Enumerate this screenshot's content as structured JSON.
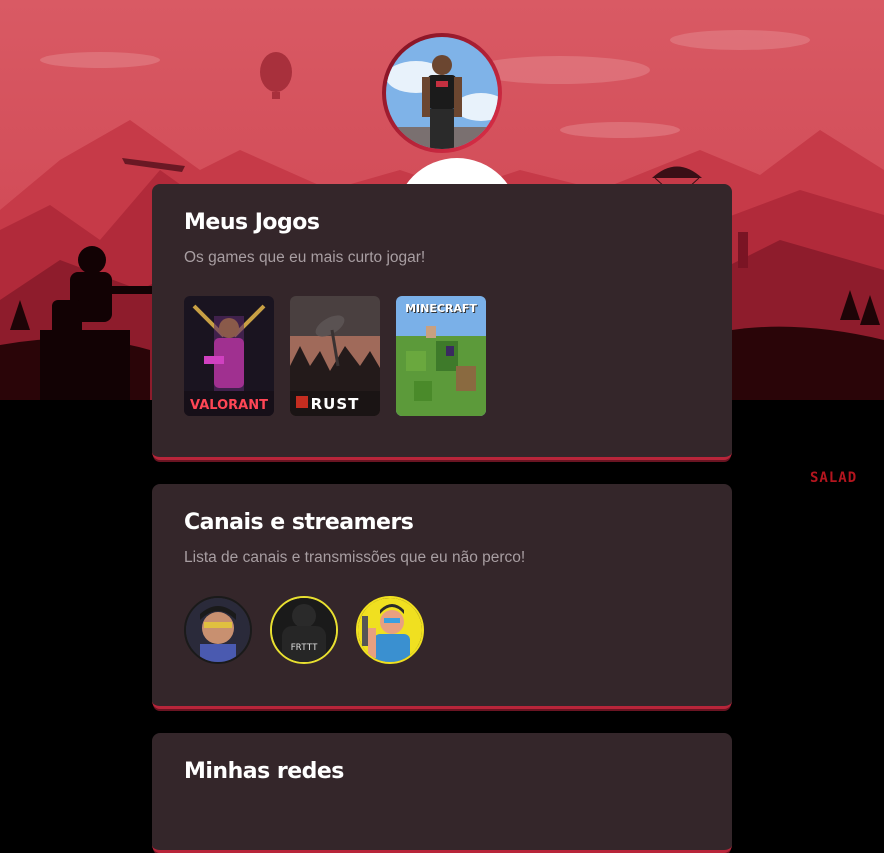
{
  "profile": {
    "avatar_icon": "profile-photo"
  },
  "sections": {
    "games": {
      "title": "Meus Jogos",
      "subtitle": "Os games que eu mais curto jogar!",
      "items": [
        {
          "name": "VALORANT",
          "icon": "valorant-cover"
        },
        {
          "name": "RUST",
          "icon": "rust-cover"
        },
        {
          "name": "MINECRAFT",
          "icon": "minecraft-cover"
        }
      ]
    },
    "streams": {
      "title": "Canais e streamers",
      "subtitle": "Lista de canais e transmissões que eu não perco!",
      "items": [
        {
          "icon": "streamer-avatar-1"
        },
        {
          "icon": "streamer-avatar-2",
          "text": "FRTTT"
        },
        {
          "icon": "streamer-avatar-3"
        }
      ]
    },
    "social": {
      "title": "Minhas redes"
    }
  },
  "background": {
    "watermark": "SALAD"
  },
  "colors": {
    "card_bg": "#34262a",
    "accent": "#b8253a",
    "sky": "#d4525e"
  }
}
